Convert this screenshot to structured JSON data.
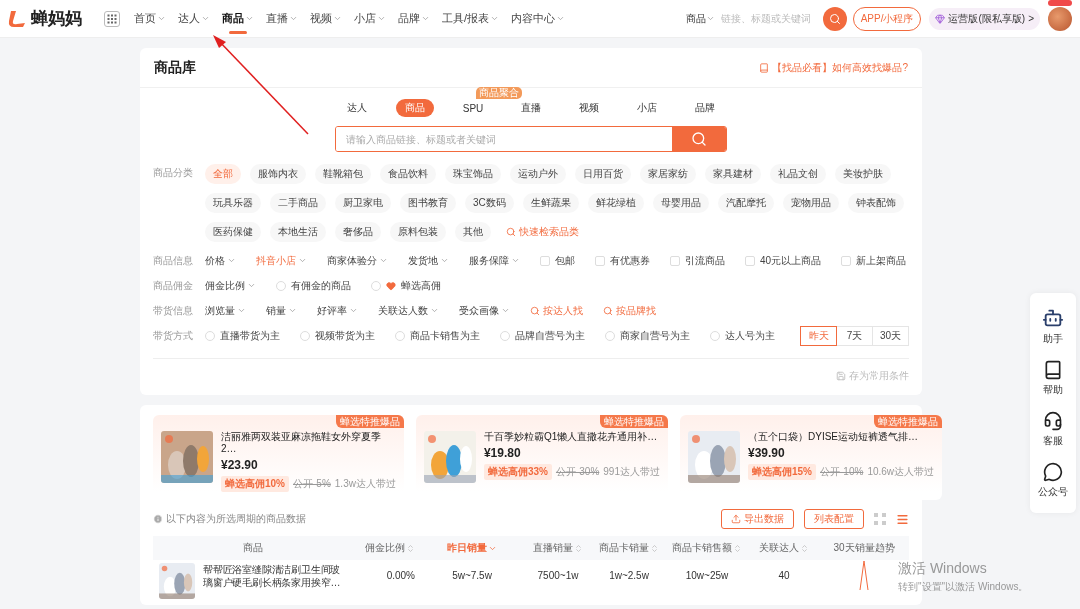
{
  "topbar": {
    "logo": "蝉妈妈",
    "nav": [
      {
        "label": "首页",
        "selected": false
      },
      {
        "label": "达人",
        "selected": false
      },
      {
        "label": "商品",
        "selected": true
      },
      {
        "label": "直播",
        "selected": false
      },
      {
        "label": "视频",
        "selected": false
      },
      {
        "label": "小店",
        "selected": false
      },
      {
        "label": "品牌",
        "selected": false
      },
      {
        "label": "工具/报表",
        "selected": false
      },
      {
        "label": "内容中心",
        "selected": false
      }
    ],
    "search": {
      "scope": "商品",
      "placeholder": "链接、标题或关键词"
    },
    "app_button": "APP/小程序",
    "plan": {
      "label": "运营版(限私享版)",
      "arrow": ">"
    }
  },
  "library": {
    "title": "商品库",
    "help_link": "【找品必看】如何高效找爆品?",
    "tabs": [
      {
        "label": "达人",
        "selected": false
      },
      {
        "label": "商品",
        "selected": true
      },
      {
        "label": "SPU",
        "selected": false,
        "badge": "商品聚合"
      },
      {
        "label": "直播",
        "selected": false
      },
      {
        "label": "视频",
        "selected": false
      },
      {
        "label": "小店",
        "selected": false
      },
      {
        "label": "品牌",
        "selected": false
      }
    ],
    "search": {
      "placeholder": "请输入商品链接、标题或者关键词"
    },
    "categories": {
      "label": "商品分类",
      "quick_search": "快速检索品类",
      "items": [
        {
          "label": "全部",
          "selected": true
        },
        {
          "label": "服饰内衣",
          "selected": false
        },
        {
          "label": "鞋靴箱包",
          "selected": false
        },
        {
          "label": "食品饮料",
          "selected": false
        },
        {
          "label": "珠宝饰品",
          "selected": false
        },
        {
          "label": "运动户外",
          "selected": false
        },
        {
          "label": "日用百货",
          "selected": false
        },
        {
          "label": "家居家纺",
          "selected": false
        },
        {
          "label": "家具建材",
          "selected": false
        },
        {
          "label": "礼品文创",
          "selected": false
        },
        {
          "label": "美妆护肤",
          "selected": false
        },
        {
          "label": "玩具乐器",
          "selected": false
        },
        {
          "label": "二手商品",
          "selected": false
        },
        {
          "label": "厨卫家电",
          "selected": false
        },
        {
          "label": "图书教育",
          "selected": false
        },
        {
          "label": "3C数码",
          "selected": false
        },
        {
          "label": "生鲜蔬果",
          "selected": false
        },
        {
          "label": "鲜花绿植",
          "selected": false
        },
        {
          "label": "母婴用品",
          "selected": false
        },
        {
          "label": "汽配摩托",
          "selected": false
        },
        {
          "label": "宠物用品",
          "selected": false
        },
        {
          "label": "钟表配饰",
          "selected": false
        },
        {
          "label": "医药保健",
          "selected": false
        },
        {
          "label": "本地生活",
          "selected": false
        },
        {
          "label": "奢侈品",
          "selected": false
        },
        {
          "label": "原料包装",
          "selected": false
        },
        {
          "label": "其他",
          "selected": false
        }
      ]
    },
    "filters": [
      {
        "label": "商品信息",
        "items": [
          {
            "kind": "dropdown",
            "label": "价格",
            "active": false
          },
          {
            "kind": "dropdown",
            "label": "抖音小店",
            "active": true
          },
          {
            "kind": "dropdown",
            "label": "商家体验分",
            "active": false
          },
          {
            "kind": "dropdown",
            "label": "发货地",
            "active": false
          },
          {
            "kind": "dropdown",
            "label": "服务保障",
            "active": false
          },
          {
            "kind": "checkbox",
            "label": "包邮",
            "checked": false
          },
          {
            "kind": "checkbox",
            "label": "有优惠券",
            "checked": false
          },
          {
            "kind": "checkbox",
            "label": "引流商品",
            "checked": false
          },
          {
            "kind": "checkbox",
            "label": "40元以上商品",
            "checked": false
          },
          {
            "kind": "checkbox",
            "label": "新上架商品",
            "checked": false
          }
        ]
      },
      {
        "label": "商品佣金",
        "items": [
          {
            "kind": "dropdown",
            "label": "佣金比例",
            "active": false
          },
          {
            "kind": "radio",
            "label": "有佣金的商品",
            "checked": false
          },
          {
            "kind": "brand",
            "label": "蝉选高佣",
            "checked": false
          }
        ]
      },
      {
        "label": "带货信息",
        "items": [
          {
            "kind": "dropdown",
            "label": "浏览量",
            "active": false
          },
          {
            "kind": "dropdown",
            "label": "销量",
            "active": false
          },
          {
            "kind": "dropdown",
            "label": "好评率",
            "active": false
          },
          {
            "kind": "dropdown",
            "label": "关联达人数",
            "active": false
          },
          {
            "kind": "dropdown",
            "label": "受众画像",
            "active": false
          },
          {
            "kind": "link",
            "label": "按达人找"
          },
          {
            "kind": "link",
            "label": "按品牌找"
          }
        ]
      },
      {
        "label": "带货方式",
        "items": [
          {
            "kind": "radio",
            "label": "直播带货为主",
            "checked": false
          },
          {
            "kind": "radio",
            "label": "视频带货为主",
            "checked": false
          },
          {
            "kind": "radio",
            "label": "商品卡销售为主",
            "checked": false
          },
          {
            "kind": "radio",
            "label": "品牌自营号为主",
            "checked": false
          },
          {
            "kind": "radio",
            "label": "商家自营号为主",
            "checked": false
          },
          {
            "kind": "radio",
            "label": "达人号为主",
            "checked": false
          }
        ]
      }
    ],
    "periods": [
      {
        "label": "昨天",
        "selected": true
      },
      {
        "label": "7天",
        "selected": false
      },
      {
        "label": "30天",
        "selected": false
      }
    ],
    "save_link": "存为常用条件"
  },
  "featured": [
    {
      "badge": "蝉选特推爆品",
      "title": "洁丽雅两双装亚麻凉拖鞋女外穿夏季2…",
      "price": "¥23.90",
      "commission": "蝉选高佣10%",
      "public": "公开-5%",
      "reach": "1.3w达人带过"
    },
    {
      "badge": "蝉选特推爆品",
      "title": "千百季妙粒霸Q1懒人直撒花卉通用补…",
      "price": "¥19.80",
      "commission": "蝉选高佣33%",
      "public": "公开-30%",
      "reach": "991达人带过"
    },
    {
      "badge": "蝉选特推爆品",
      "title": "（五个口袋）DYISE运动短裤透气排…",
      "price": "¥39.90",
      "commission": "蝉选高佣15%",
      "public": "公开-10%",
      "reach": "10.6w达人带过"
    }
  ],
  "table": {
    "note": "以下内容为所选周期的商品数据",
    "export_button": "导出数据",
    "config_button": "列表配置",
    "views": [
      {
        "kind": "grid",
        "selected": false
      },
      {
        "kind": "list",
        "selected": true
      }
    ],
    "columns": [
      {
        "label": "商品",
        "sortable": false,
        "sorted": false
      },
      {
        "label": "佣金比例",
        "sortable": true,
        "sorted": false
      },
      {
        "label": "昨日销量",
        "sortable": true,
        "sorted": true
      },
      {
        "label": "直播销量",
        "sortable": true,
        "sorted": false
      },
      {
        "label": "商品卡销量",
        "sortable": true,
        "sorted": false
      },
      {
        "label": "商品卡销售额",
        "sortable": true,
        "sorted": false
      },
      {
        "label": "关联达人",
        "sortable": true,
        "sorted": false
      },
      {
        "label": "30天销量趋势",
        "sortable": false,
        "sorted": false
      }
    ],
    "rows": [
      {
        "cells": [
          "帮帮匠浴室缝隙清洁刷卫生间玻璃窗户硬毛刷长柄条家用挨窄…",
          "0.00%",
          "5w~7.5w",
          "7500~1w",
          "1w~2.5w",
          "10w~25w",
          "40"
        ]
      }
    ]
  },
  "sidebar": [
    {
      "kind": "assistant",
      "label": "助手"
    },
    {
      "kind": "help",
      "label": "帮助"
    },
    {
      "kind": "service",
      "label": "客服"
    },
    {
      "kind": "wechat",
      "label": "公众号"
    }
  ],
  "system_notice": {
    "title": "激活 Windows",
    "subtitle": "转到\"设置\"以激活 Windows。"
  }
}
